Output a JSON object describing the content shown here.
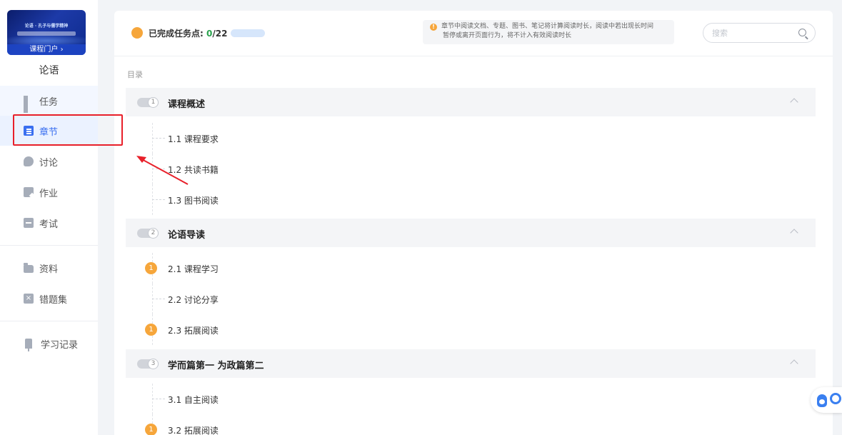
{
  "sidebar": {
    "cover": {
      "line1": "论语 · 孔子与儒学精神",
      "portal_label": "课程门户 ›"
    },
    "course_name": "论语",
    "items": [
      {
        "label": "任务",
        "icon": "grid-icon"
      },
      {
        "label": "章节",
        "icon": "chapter-list-icon"
      },
      {
        "label": "讨论",
        "icon": "discussion-icon"
      },
      {
        "label": "作业",
        "icon": "homework-icon"
      },
      {
        "label": "考试",
        "icon": "exam-icon"
      },
      {
        "label": "资料",
        "icon": "folder-icon"
      },
      {
        "label": "错题集",
        "icon": "wrong-questions-icon"
      },
      {
        "label": "学习记录",
        "icon": "study-record-icon"
      }
    ],
    "active_index": 1
  },
  "topbar": {
    "progress_label": "已完成任务点: ",
    "progress_done": "0",
    "progress_total": "/22",
    "notice_line1": "章节中阅读文档、专题、图书、笔记将计算阅读时长，阅读中若出现长时间",
    "notice_line2": "暂停或离开页面行为，将不计入有效阅读时长",
    "search_placeholder": "搜索"
  },
  "toc": {
    "title": "目录",
    "sections": [
      {
        "number": "1",
        "title": "课程概述",
        "items": [
          {
            "label": "1.1 课程要求",
            "badge": ""
          },
          {
            "label": "1.2 共读书籍",
            "badge": ""
          },
          {
            "label": "1.3 图书阅读",
            "badge": ""
          }
        ]
      },
      {
        "number": "2",
        "title": "论语导读",
        "items": [
          {
            "label": "2.1 课程学习",
            "badge": "1"
          },
          {
            "label": "2.2 讨论分享",
            "badge": ""
          },
          {
            "label": "2.3 拓展阅读",
            "badge": "1"
          }
        ]
      },
      {
        "number": "3",
        "title": "学而篇第一 为政篇第二",
        "items": [
          {
            "label": "3.1 自主阅读",
            "badge": ""
          },
          {
            "label": "3.2 拓展阅读",
            "badge": "1"
          }
        ]
      }
    ]
  },
  "colors": {
    "accent": "#3a6ff0",
    "badge": "#f6a63b",
    "highlight_box": "#e8202a",
    "progress_done": "#2aa24e"
  }
}
